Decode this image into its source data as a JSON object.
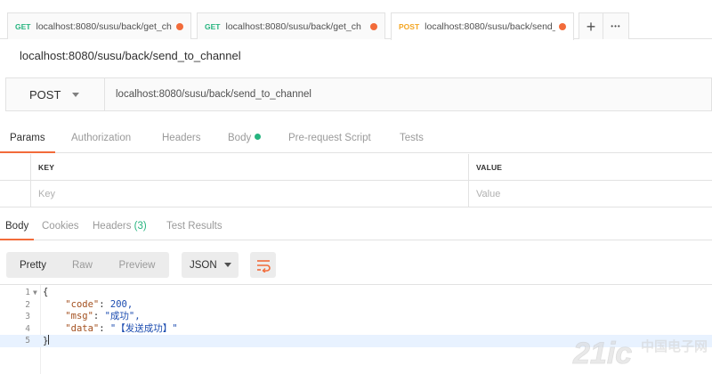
{
  "tabs": [
    {
      "method": "GET",
      "url": "localhost:8080/susu/back/get_ch",
      "method_color": "#26b47f",
      "active": false
    },
    {
      "method": "GET",
      "url": "localhost:8080/susu/back/get_ch",
      "method_color": "#26b47f",
      "active": false
    },
    {
      "method": "POST",
      "url": "localhost:8080/susu/back/send_",
      "method_color": "#f4a623",
      "active": true
    }
  ],
  "tab_actions": {
    "add": "+",
    "more": "•••"
  },
  "request": {
    "title": "localhost:8080/susu/back/send_to_channel",
    "method": "POST",
    "url": "localhost:8080/susu/back/send_to_channel"
  },
  "request_tabs": [
    "Params",
    "Authorization",
    "Headers",
    "Body",
    "Pre-request Script",
    "Tests"
  ],
  "params": {
    "headers": {
      "key": "KEY",
      "value": "VALUE"
    },
    "placeholders": {
      "key": "Key",
      "value": "Value"
    }
  },
  "response_tabs": {
    "body": "Body",
    "cookies": "Cookies",
    "headers": "Headers",
    "headers_count": "(3)",
    "test_results": "Test Results"
  },
  "response_view": {
    "modes": [
      "Pretty",
      "Raw",
      "Preview"
    ],
    "format": "JSON"
  },
  "code_lines": [
    {
      "n": "1",
      "text": "{"
    },
    {
      "n": "2",
      "key": "\"code\"",
      "value": "200,"
    },
    {
      "n": "3",
      "key": "\"msg\"",
      "value": "\"成功\","
    },
    {
      "n": "4",
      "key": "\"data\"",
      "value": "\"【发送成功】\""
    },
    {
      "n": "5",
      "text": "}"
    }
  ],
  "watermark": {
    "brand": "21ic",
    "site": "中国电子网"
  },
  "colors": {
    "accent": "#f26b3a",
    "get": "#26b47f",
    "post": "#f4a623",
    "dot": "#f26b3a"
  }
}
